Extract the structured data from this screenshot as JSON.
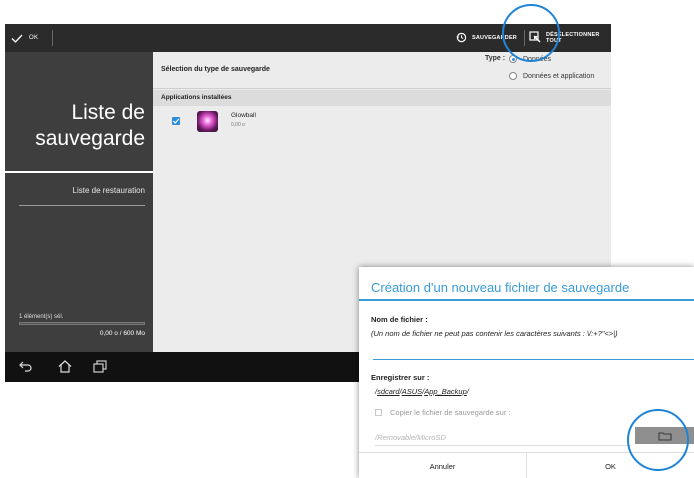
{
  "topbar": {
    "ok_label": "OK",
    "save_label": "SAUVEGARDER",
    "deselect_label": "DÉSÉLECTIONNER TOUT"
  },
  "sidebar": {
    "title": "Liste de sauvegarde",
    "restore_item": "Liste de restauration",
    "selection_status": "1 élément(s) sél.",
    "usage_fraction": 0.0,
    "size_text": "0,00 o / 600 Mo"
  },
  "main": {
    "header_title": "Sélection du type de sauvegarde",
    "type_label": "Type :",
    "type_options": [
      {
        "label": "Données",
        "selected": true
      },
      {
        "label": "Données et application",
        "selected": false
      }
    ],
    "section_title": "Applications installées",
    "apps": [
      {
        "name": "Glowball",
        "size": "0,00 o",
        "checked": true
      }
    ]
  },
  "dialog": {
    "title": "Création d'un nouveau fichier de sauvegarde",
    "filename_label": "Nom de fichier :",
    "filename_note": "(Un nom de fichier ne peut pas contenir les caractères suivants : \\/:+?\"<>|)",
    "filename_value": "",
    "save_to_label": "Enregistrer sur :",
    "path_parts": [
      "sdcard",
      "ASUS",
      "App_Backup"
    ],
    "copy_label": "Copier le fichier de sauvegarde sur :",
    "copy_checked": false,
    "copy_path_placeholder": "/Removable/MicroSD",
    "cancel_label": "Annuler",
    "ok_label": "OK"
  },
  "colors": {
    "accent": "#3a9bd9",
    "highlight": "#1f84d6",
    "topbar": "#2b2b2b",
    "sidebar": "#3e3e3e"
  }
}
